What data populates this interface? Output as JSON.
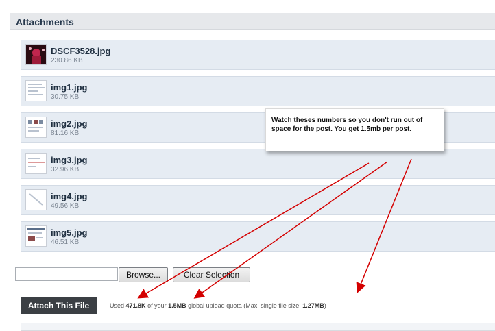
{
  "panel": {
    "title": "Attachments"
  },
  "attachments": [
    {
      "name": "DSCF3528.jpg",
      "size": "230.86 KB",
      "thumb": "photo"
    },
    {
      "name": "img1.jpg",
      "size": "30.75 KB",
      "thumb": "screenshot"
    },
    {
      "name": "img2.jpg",
      "size": "81.16 KB",
      "thumb": "screenshot"
    },
    {
      "name": "img3.jpg",
      "size": "32.96 KB",
      "thumb": "screenshot"
    },
    {
      "name": "img4.jpg",
      "size": "49.56 KB",
      "thumb": "screenshot"
    },
    {
      "name": "img5.jpg",
      "size": "46.51 KB",
      "thumb": "screenshot"
    }
  ],
  "upload": {
    "browse_label": "Browse...",
    "clear_label": "Clear Selection",
    "attach_label": "Attach This File"
  },
  "quota": {
    "prefix": "Used",
    "used": "471.8K",
    "middle": "of your",
    "total": "1.5MB",
    "suffix": "global upload quota (Max. single file size:",
    "max": "1.27MB",
    "end": ")"
  },
  "callout": {
    "text": "Watch theses numbers so you don't run out of space for the post. You get 1.5mb per post."
  },
  "colors": {
    "arrow": "#d40000",
    "header_text": "#27394d",
    "row_bg": "#e6ecf3"
  }
}
